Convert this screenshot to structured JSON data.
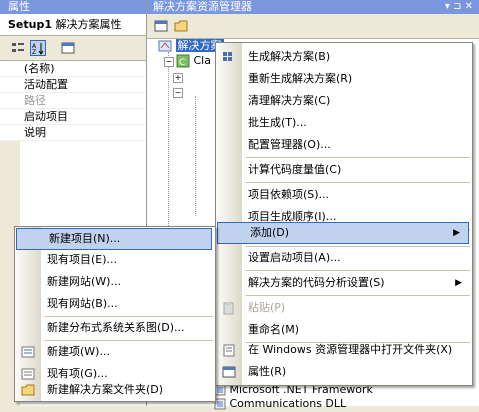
{
  "properties": {
    "title": "属性",
    "object_name": "Setup1",
    "object_type": "解决方案属性",
    "rows": [
      {
        "label": "(名称)",
        "gray": false
      },
      {
        "label": "活动配置",
        "gray": false
      },
      {
        "label": "路径",
        "gray": true
      },
      {
        "label": "启动项目",
        "gray": false
      },
      {
        "label": "说明",
        "gray": false
      }
    ]
  },
  "solution_explorer": {
    "title": "解决方案资源管理器",
    "title_controls": "▾ ⊐ ✕",
    "selected_item": "解决方案",
    "tree_item_partial": "Cla",
    "bottom_items": [
      "Microsoft .NET Framework",
      "Communications DLL"
    ]
  },
  "main_menu": {
    "items": [
      {
        "label": "生成解决方案(B)",
        "icon": "build-icon"
      },
      {
        "label": "重新生成解决方案(R)"
      },
      {
        "label": "清理解决方案(C)"
      },
      {
        "label": "批生成(T)..."
      },
      {
        "label": "配置管理器(O)..."
      },
      {
        "label": "计算代码度量值(C)"
      },
      {
        "label": "项目依赖项(S)..."
      },
      {
        "label": "项目生成顺序(I)..."
      },
      {
        "label": "添加(D)",
        "submenu": true,
        "highlighted": true
      },
      {
        "label": "设置启动项目(A)..."
      },
      {
        "label": "解决方案的代码分析设置(S)",
        "submenu": true
      },
      {
        "label": "粘贴(P)",
        "disabled": true,
        "icon": "paste-icon"
      },
      {
        "label": "重命名(M)"
      },
      {
        "label": "在 Windows 资源管理器中打开文件夹(X)",
        "icon": "open-folder-icon"
      },
      {
        "label": "属性(R)",
        "icon": "properties-icon"
      }
    ]
  },
  "add_submenu": {
    "items": [
      {
        "label": "新建项目(N)...",
        "highlighted": true
      },
      {
        "label": "现有项目(E)..."
      },
      {
        "label": "新建网站(W)..."
      },
      {
        "label": "现有网站(B)..."
      },
      {
        "label": "新建分布式系统关系图(D)..."
      },
      {
        "label": "新建项(W)...",
        "icon": "new-item-icon"
      },
      {
        "label": "现有项(G)...",
        "icon": "existing-item-icon"
      },
      {
        "label": "新建解决方案文件夹(D)",
        "icon": "solution-folder-icon"
      }
    ]
  }
}
